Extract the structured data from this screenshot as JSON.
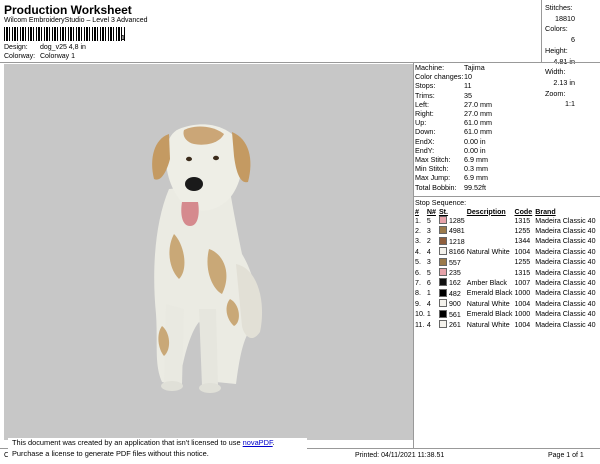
{
  "header": {
    "title": "Production Worksheet",
    "subtitle": "Wilcom EmbroideryStudio – Level 3 Advanced",
    "barcode_mark": "1",
    "design_label": "Design:",
    "design_value": "dog_v25 4,8 in",
    "colorway_label": "Colorway:",
    "colorway_value": "Colorway 1"
  },
  "stats": [
    {
      "label": "Stitches:",
      "value": "18810"
    },
    {
      "label": "Colors:",
      "value": "6"
    },
    {
      "label": "Height:",
      "value": "4.81 in"
    },
    {
      "label": "Width:",
      "value": "2.13 in"
    },
    {
      "label": "Zoom:",
      "value": "1:1"
    }
  ],
  "params": [
    {
      "label": "Machine:",
      "value": "Tajima"
    },
    {
      "label": "Color changes:",
      "value": "10"
    },
    {
      "label": "Stops:",
      "value": "11"
    },
    {
      "label": "Trims:",
      "value": "35"
    },
    {
      "label": "Left:",
      "value": "27.0 mm"
    },
    {
      "label": "Right:",
      "value": "27.0 mm"
    },
    {
      "label": "Up:",
      "value": "61.0 mm"
    },
    {
      "label": "Down:",
      "value": "61.0 mm"
    },
    {
      "label": "EndX:",
      "value": "0.00 in"
    },
    {
      "label": "EndY:",
      "value": "0.00 in"
    },
    {
      "label": "Max Stitch:",
      "value": "6.9 mm"
    },
    {
      "label": "Min Stitch:",
      "value": "0.3 mm"
    },
    {
      "label": "Max Jump:",
      "value": "6.9 mm"
    },
    {
      "label": "Total Bobbin:",
      "value": "99.52ft"
    }
  ],
  "sequence": {
    "title": "Stop Sequence:",
    "headers": [
      "#",
      "N#",
      "St.",
      "Description",
      "Code",
      "Brand"
    ],
    "rows": [
      {
        "n": "1.",
        "needle": "5",
        "color": "#e7a3aa",
        "st": "1285",
        "desc": "",
        "code": "1315",
        "brand": "Madeira Classic 40"
      },
      {
        "n": "2.",
        "needle": "3",
        "color": "#9b7a4b",
        "st": "4981",
        "desc": "",
        "code": "1255",
        "brand": "Madeira Classic 40"
      },
      {
        "n": "3.",
        "needle": "2",
        "color": "#8f5e3c",
        "st": "1218",
        "desc": "",
        "code": "1344",
        "brand": "Madeira Classic 40"
      },
      {
        "n": "4.",
        "needle": "4",
        "color": "#f4f2ec",
        "st": "8166",
        "desc": "Natural White",
        "code": "1004",
        "brand": "Madeira Classic 40"
      },
      {
        "n": "5.",
        "needle": "3",
        "color": "#9b7a4b",
        "st": "557",
        "desc": "",
        "code": "1255",
        "brand": "Madeira Classic 40"
      },
      {
        "n": "6.",
        "needle": "5",
        "color": "#e7a3aa",
        "st": "235",
        "desc": "",
        "code": "1315",
        "brand": "Madeira Classic 40"
      },
      {
        "n": "7.",
        "needle": "6",
        "color": "#111111",
        "st": "162",
        "desc": "Amber Black",
        "code": "1007",
        "brand": "Madeira Classic 40"
      },
      {
        "n": "8.",
        "needle": "1",
        "color": "#000000",
        "st": "482",
        "desc": "Emerald Black",
        "code": "1000",
        "brand": "Madeira Classic 40"
      },
      {
        "n": "9.",
        "needle": "4",
        "color": "#f4f2ec",
        "st": "900",
        "desc": "Natural White",
        "code": "1004",
        "brand": "Madeira Classic 40"
      },
      {
        "n": "10.",
        "needle": "1",
        "color": "#000000",
        "st": "561",
        "desc": "Emerald Black",
        "code": "1000",
        "brand": "Madeira Classic 40"
      },
      {
        "n": "11.",
        "needle": "4",
        "color": "#f4f2ec",
        "st": "261",
        "desc": "Natural White",
        "code": "1004",
        "brand": "Madeira Classic 40"
      }
    ]
  },
  "footer": {
    "left_fragment": "Cr",
    "printed": "Printed: 04/11/2021 11:38.51",
    "page": "Page 1 of 1",
    "notice_line1": "This document was created by an application that isn't licensed to use ",
    "notice_link": "novaPDF",
    "notice_line1_end": ".",
    "notice_line2": "Purchase a license to generate PDF files without this notice."
  },
  "colors": {
    "canvas": "#c7c7c7",
    "tan": "#c9a877",
    "white_fur": "#eeeee8"
  }
}
